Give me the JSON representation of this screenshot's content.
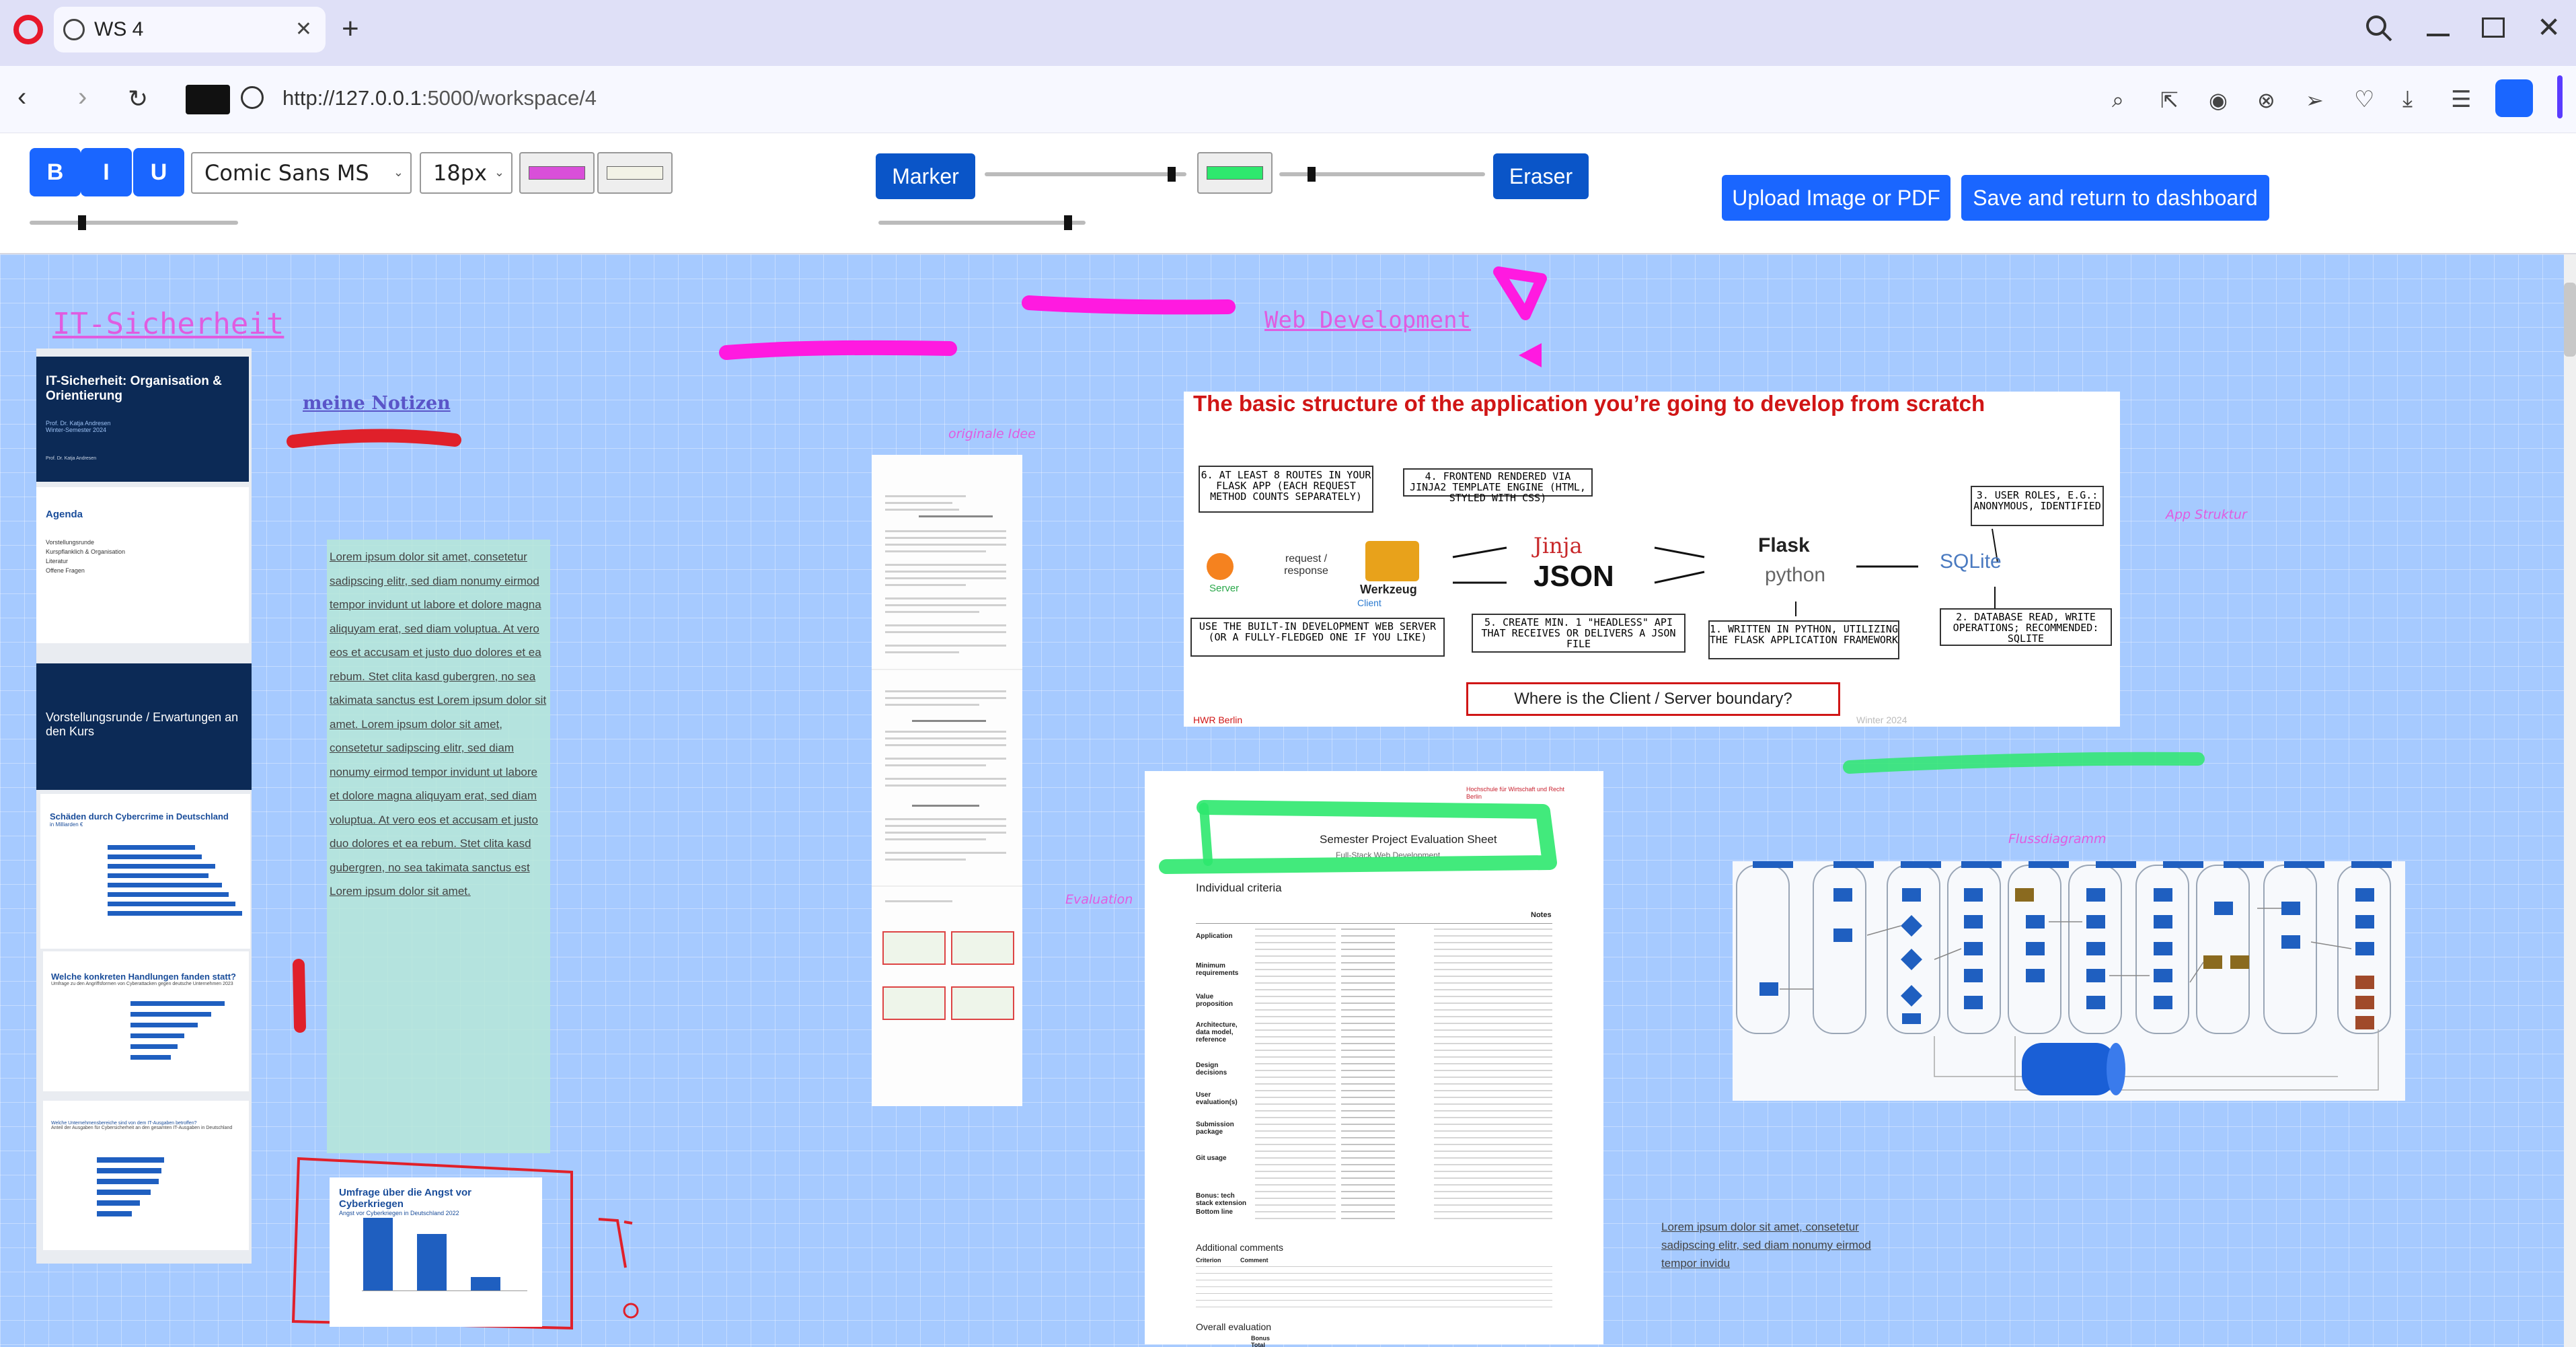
{
  "browser": {
    "tab_title": "WS 4",
    "url_prefix": "http://127.0.0.1",
    "url_rest": ":5000/workspace/4"
  },
  "toolbar": {
    "bold_label": "B",
    "italic_label": "I",
    "underline_label": "U",
    "font_family_value": "Comic Sans MS",
    "font_size_value": "18px",
    "text_color": "#d94fd9",
    "bg_color": "#f2f2e6",
    "marker_label": "Marker",
    "marker_color": "#2ee86e",
    "eraser_label": "Eraser",
    "upload_label": "Upload Image or PDF",
    "save_label": "Save and return to dashboard"
  },
  "colors": {
    "accent": "#1a66ff",
    "magenta": "#ff1ae0",
    "green": "#2ee86e",
    "red": "#e0202a",
    "canvas": "#a6caff"
  },
  "canvas": {
    "title_it": "IT-Sicherheit",
    "notes_title": "meine Notizen",
    "web_dev_title": "Web Development",
    "label_idee": "originale Idee",
    "label_app_struktur": "App Struktur",
    "label_evaluation": "Evaluation",
    "label_flussdiagramm": "Flussdiagramm",
    "lorem_long": "Lorem ipsum dolor sit amet, consetetur sadipscing elitr, sed diam nonumy eirmod tempor invidunt ut labore et dolore magna aliquyam erat, sed diam voluptua. At vero eos et accusam et justo duo dolores et ea rebum. Stet clita kasd gubergren, no sea takimata sanctus est Lorem ipsum dolor sit amet. Lorem ipsum dolor sit amet, consetetur sadipscing elitr, sed diam nonumy eirmod tempor invidunt ut labore et dolore magna aliquyam erat, sed diam voluptua. At vero eos et accusam et justo duo dolores et ea rebum. Stet clita kasd gubergren, no sea takimata sanctus est Lorem ipsum dolor sit amet.",
    "lorem_short": "Lorem ipsum dolor sit amet, consetetur sadipscing elitr, sed diam nonumy eirmod tempor invidu"
  },
  "slides": {
    "s1_title": "IT-Sicherheit: Organisation & Orientierung",
    "s1_sub": "Prof. Dr. Katja Andresen\nWinter-Semester 2024",
    "s1_footer": "Prof. Dr. Katja Andresen",
    "s2_title": "Agenda",
    "s2_items": "Vorstellungsrunde\nKurspflanklich & Organisation\nLiteratur\nOffene Fragen",
    "s3_title": "Vorstellungsrunde / Erwartungen an den Kurs",
    "s4_title": "Schäden durch Cybercrime in Deutschland",
    "s4_sub": "in Milliarden €",
    "s5_title": "Welche konkreten Handlungen fanden statt?",
    "s5_sub": "Umfrage zu den Angriffsformen von Cyberattacken gegen deutsche Unternehmen 2023",
    "s6_title": "Welche Unternehmensbereiche sind von dem IT-Ausgaben betroffen?",
    "s6_sub": "Anteil der Ausgaben für Cybersicherheit an den gesamten IT-Ausgaben in Deutschland",
    "survey_title": "Umfrage über die Angst vor Cyberkriegen",
    "survey_sub": "Angst vor Cyberkriegen in Deutschland 2022"
  },
  "diagram": {
    "title": "The basic structure of the application you’re going to develop from scratch",
    "box1": "6. AT LEAST 8 ROUTES IN YOUR FLASK APP (EACH REQUEST METHOD COUNTS SEPARATELY)",
    "box2": "4. FRONTEND RENDERED VIA JINJA2 TEMPLATE ENGINE (HTML, STYLED WITH CSS)",
    "box3": "3. USER ROLES, E.G.: ANONYMOUS, IDENTIFIED",
    "box4": "USE THE BUILT-IN DEVELOPMENT WEB SERVER (OR A FULLY-FLEDGED ONE IF YOU LIKE)",
    "box5": "5. CREATE MIN. 1 \"HEADLESS\" API THAT RECEIVES OR DELIVERS A JSON FILE",
    "box6": "1. WRITTEN IN PYTHON, UTILIZING THE FLASK APPLICATION FRAMEWORK",
    "box7": "2. DATABASE READ, WRITE OPERATIONS; RECOMMENDED: SQLITE",
    "request_label": "request / response",
    "server_label": "Server",
    "client_label": "Client",
    "werkzeug": "Werkzeug",
    "jinja": "Jinja",
    "json": "JSON",
    "flask": "Flask",
    "python": "python",
    "sqlite": "SQLite",
    "boundary": "Where is the Client / Server boundary?",
    "footer_left": "HWR Berlin",
    "footer_right": "Winter 2024"
  },
  "evaluation": {
    "institution": "Hochschule für Wirtschaft und Recht Berlin",
    "title": "Semester Project Evaluation Sheet",
    "subtitle": "Full-Stack Web Development",
    "individual": "Individual criteria",
    "notes_header": "Notes",
    "rows": [
      "Application",
      "Minimum requirements",
      "Value proposition",
      "Architecture, data model, reference",
      "Design decisions",
      "User evaluation(s)",
      "Submission package",
      "Git usage",
      "Bonus: tech stack extension",
      "Bottom line"
    ],
    "additional": "Additional comments",
    "criterion": "Criterion",
    "comment": "Comment",
    "overall": "Overall evaluation",
    "bonus": "Bonus",
    "total": "Total"
  }
}
